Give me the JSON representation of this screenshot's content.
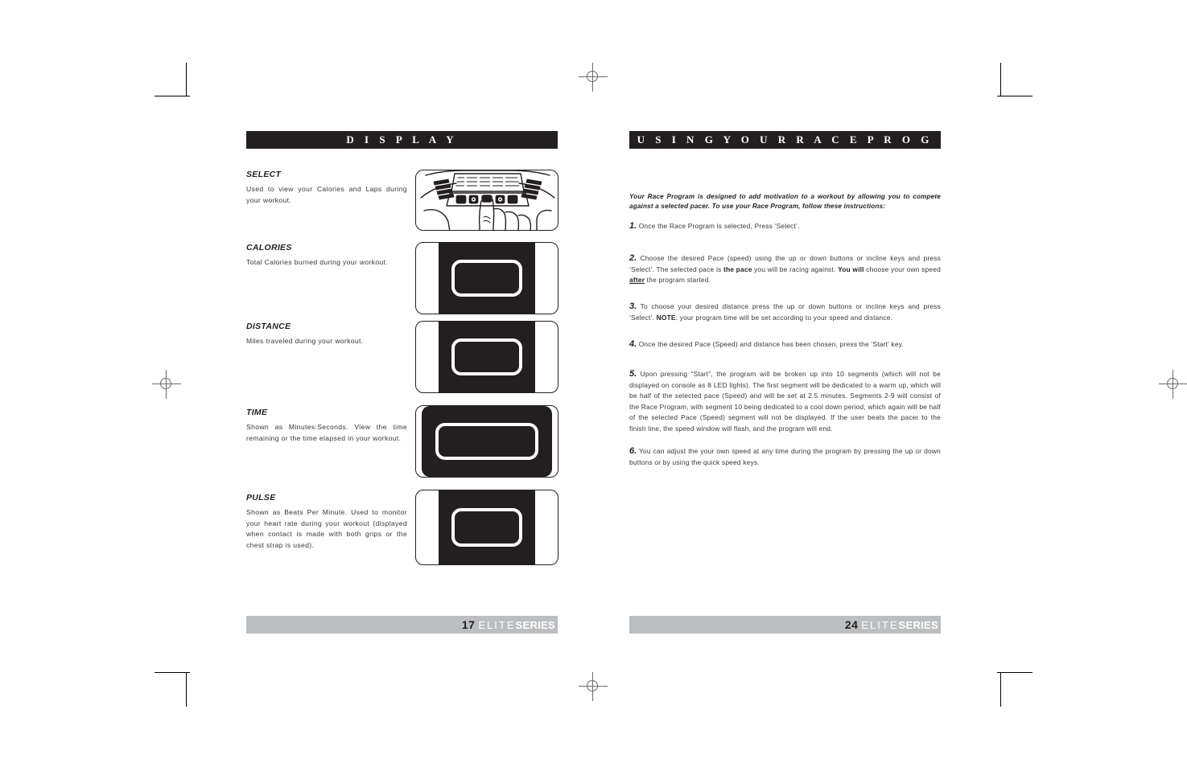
{
  "document": {
    "page_left": {
      "header": "D I S P L A Y",
      "footer": {
        "page_number": "17",
        "brand_1": "ELITE",
        "brand_2": "SERIES"
      },
      "entries": [
        {
          "title": "SELECT",
          "body": "Used to view your Calories and Laps during your workout.",
          "art": "console-hand-pressing-select-button"
        },
        {
          "title": "CALORIES",
          "body": "Total Calories burned during your workout.",
          "art": "lcd-display-panel"
        },
        {
          "title": "DISTANCE",
          "body": "Miles traveled during your workout.",
          "art": "lcd-display-panel"
        },
        {
          "title": "TIME",
          "body": "Shown as Minutes:Seconds. View the time remaining or the time elapsed in your workout.",
          "art": "lcd-display-panel-wide"
        },
        {
          "title": "PULSE",
          "body": "Shown as Beats Per Minute. Used to monitor your heart rate during your workout (displayed when contact is made with both grips or the chest strap is used).",
          "art": "lcd-display-panel"
        }
      ]
    },
    "page_right": {
      "header": "U S I N G   Y O U R   R A C E   P R O G R A M",
      "footer": {
        "page_number": "24",
        "brand_1": "ELITE",
        "brand_2": "SERIES"
      },
      "intro": "Your Race Program is designed to add motivation to a workout by allowing you to compete against a selected pacer. To use your Race Program, follow these instructions:",
      "steps": [
        {
          "number": "1.",
          "text": "Once the Race Program is selected, Press ‘Select’."
        },
        {
          "number": "2.",
          "text_a": "Choose the desired Pace (speed) using the up or down buttons or incline keys and press ‘Select’. The selected pace is ",
          "bold_a": "the pace",
          "text_b": " you will be racing against. ",
          "bold_b": "You will",
          "text_c": " choose your own speed ",
          "underline": "after",
          "text_d": " the program started."
        },
        {
          "number": "3.",
          "text_a": "To choose your desired distance press the up or down buttons or incline keys and press ‘Select’. ",
          "bold_a": "NOTE",
          "text_b": ": your program time will be set according to your speed and distance."
        },
        {
          "number": "4.",
          "text": "Once the desired Pace (Speed) and distance has been chosen, press the ‘Start’ key."
        },
        {
          "number": "5.",
          "text": "Upon pressing “Start”, the program will be broken up into 10 segments (which will not be displayed on console as 8 LED lights). The first segment will be dedicated to a warm up, which will be half of the selected pace (Speed) and will be set at 2.5 minutes. Segments 2-9 will consist of the Race Program, with segment 10 being dedicated to a cool down period, which again will be half of the selected Pace (Speed) segment will not be displayed. If the user beats the pacer to the finish line, the speed window will flash, and the program will end."
        },
        {
          "number": "6.",
          "text": "You can adjust the your own speed at any time during the program by pressing the up or down buttons or by using the quick speed keys."
        }
      ]
    }
  },
  "colors": {
    "ink": "#231f20",
    "header_bar": "#231f20",
    "footer_bar": "#bcbec0",
    "paper": "#ffffff"
  }
}
